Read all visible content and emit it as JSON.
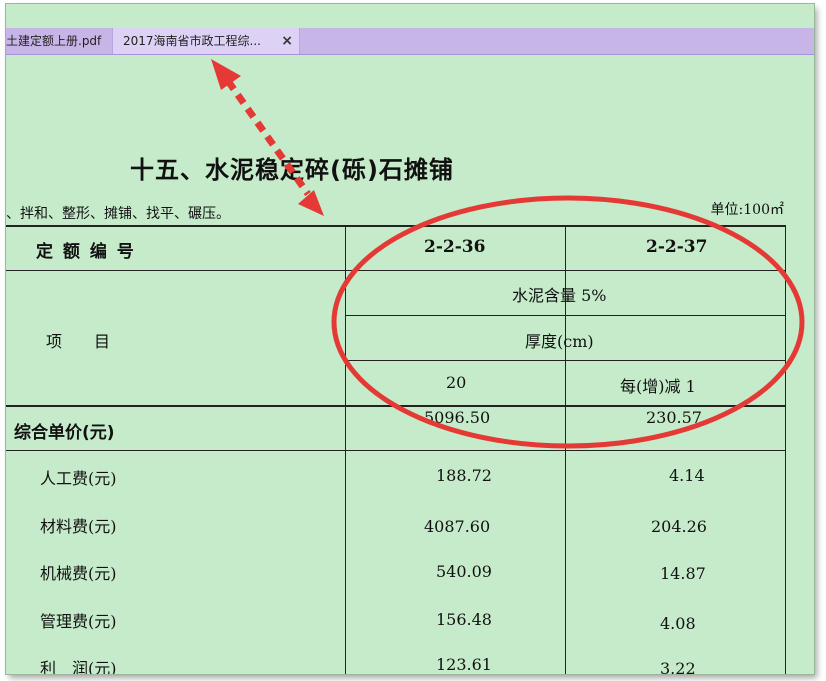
{
  "tabs": [
    {
      "label": "土建定额上册.pdf"
    },
    {
      "label": "2017海南省市政工程综...",
      "close": "×"
    }
  ],
  "document": {
    "title": "十五、水泥稳定碎(砾)石摊铺",
    "work_note": "、拌和、整形、摊铺、找平、碾压。",
    "unit": "单位:100㎡",
    "table": {
      "quota_label": "定 额 编 号",
      "codes": [
        "2-2-36",
        "2-2-37"
      ],
      "item_label": "项　　目",
      "cement_content": "水泥含量 5%",
      "thickness": "厚度(cm)",
      "thickness_values": [
        "20",
        "每(增)减 1"
      ],
      "unit_price_label": "综合单价(元)",
      "unit_price_values": [
        "5096.50",
        "230.57"
      ],
      "rows": [
        {
          "label": "人工费(元)",
          "v1": "188.72",
          "v2": "4.14"
        },
        {
          "label": "材料费(元)",
          "v1": "4087.60",
          "v2": "204.26"
        },
        {
          "label": "机械费(元)",
          "v1": "540.09",
          "v2": "14.87"
        },
        {
          "label": "管理费(元)",
          "v1": "156.48",
          "v2": "4.08"
        },
        {
          "label": "利　润(元)",
          "v1": "123.61",
          "v2": "3.22"
        }
      ]
    }
  },
  "annotation": {
    "arrow_color": "#e53935",
    "ellipse_color": "#e53935"
  }
}
